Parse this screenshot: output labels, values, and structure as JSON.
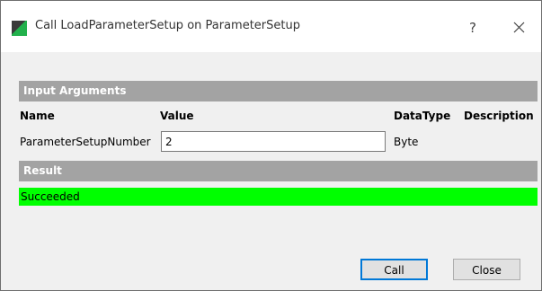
{
  "window": {
    "title": "Call LoadParameterSetup on ParameterSetup",
    "help_label": "?",
    "icon": "app-icon"
  },
  "input_section": {
    "title": "Input Arguments",
    "columns": [
      "Name",
      "Value",
      "DataType",
      "Description"
    ],
    "rows": [
      {
        "name": "ParameterSetupNumber",
        "value": "2",
        "datatype": "Byte",
        "description": ""
      }
    ]
  },
  "result_section": {
    "title": "Result",
    "status": "Succeeded",
    "status_color": "#00ff00"
  },
  "buttons": {
    "call_label": "Call",
    "close_label": "Close"
  },
  "colors": {
    "section_bar": "#a3a3a3",
    "default_button_border": "#0078d7"
  }
}
